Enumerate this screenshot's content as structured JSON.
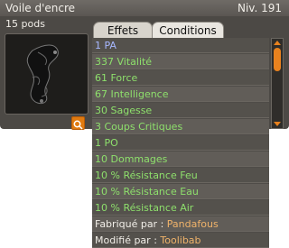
{
  "window": {
    "title": "Voile d'encre",
    "level": "Niv. 191",
    "pods": "15 pods"
  },
  "tabs": [
    {
      "label": "Effets",
      "active": true
    },
    {
      "label": "Conditions",
      "active": false
    }
  ],
  "effects": [
    {
      "text": "1 PA",
      "color": "#a7b8ff"
    },
    {
      "text": "337 Vitalité",
      "color": "#8ee06c"
    },
    {
      "text": "61 Force",
      "color": "#8ee06c"
    },
    {
      "text": "67 Intelligence",
      "color": "#8ee06c"
    },
    {
      "text": "30 Sagesse",
      "color": "#8ee06c"
    },
    {
      "text": "3 Coups Critiques",
      "color": "#8ee06c"
    },
    {
      "text": "1 PO",
      "color": "#8ee06c"
    },
    {
      "text": "10 Dommages",
      "color": "#8ee06c"
    },
    {
      "text": "10 % Résistance Feu",
      "color": "#8ee06c"
    },
    {
      "text": "10 % Résistance Eau",
      "color": "#8ee06c"
    },
    {
      "text": "10 % Résistance Air",
      "color": "#8ee06c"
    }
  ],
  "crafted": {
    "label": "Fabriqué par :",
    "name": "Pandafous"
  },
  "modified": {
    "label": "Modifié par :",
    "name": "Toolibab"
  },
  "icons": {
    "item": "dark-ink-veil-icon",
    "search": "search-icon",
    "scroll_up": "chevron-up-icon",
    "scroll_down": "chevron-down-icon"
  },
  "colors": {
    "accent": "#e07a10",
    "effect_text": "#8ee06c",
    "pa_text": "#a7b8ff",
    "maker_name": "#f0b36a"
  }
}
